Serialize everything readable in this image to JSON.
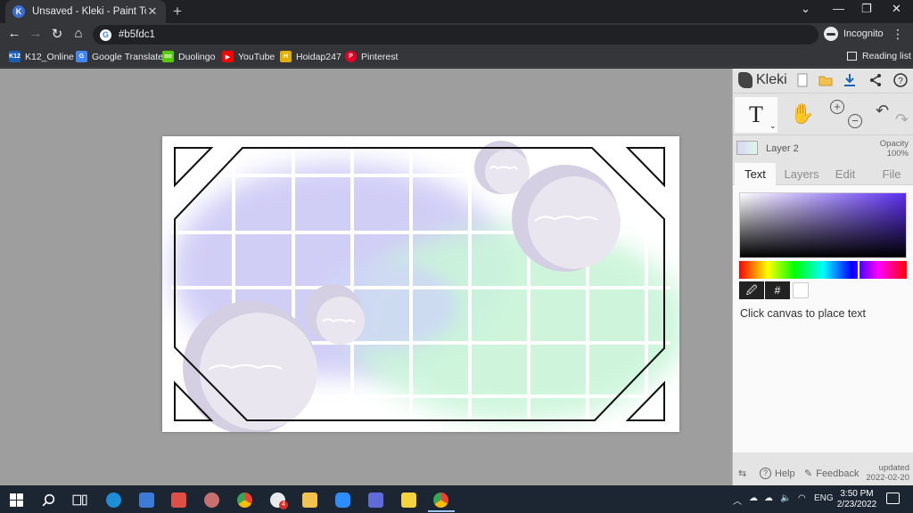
{
  "browser": {
    "tab_title": "Unsaved - Kleki - Paint Tool",
    "tab_favicon": "kleki-icon",
    "new_tab": "+",
    "url": "#b5fdc1",
    "incognito_label": "Incognito",
    "reading_list": "Reading list",
    "bookmarks": [
      {
        "label": "K12_Online",
        "icon_text": "K12",
        "color": "#1a5fb4"
      },
      {
        "label": "Google Translate",
        "icon_text": "G",
        "color": "#4285f4"
      },
      {
        "label": "Duolingo",
        "icon_text": "oo",
        "color": "#58cc02"
      },
      {
        "label": "YouTube",
        "icon_text": "▶",
        "color": "#ff0000"
      },
      {
        "label": "Hoidap247",
        "icon_text": "H",
        "color": "#e0b000"
      },
      {
        "label": "Pinterest",
        "icon_text": "P",
        "color": "#e60023"
      }
    ]
  },
  "kleki": {
    "logo": "Kleki",
    "layer_name": "Layer 2",
    "opacity_label": "Opacity",
    "opacity_value": "100%",
    "tabs": [
      {
        "label": "Text",
        "active": true
      },
      {
        "label": "Layers",
        "active": false
      },
      {
        "label": "Edit",
        "active": false
      },
      {
        "label": "File",
        "active": false
      }
    ],
    "hex_button": "#",
    "hint": "Click canvas to place text",
    "footer": {
      "help": "Help",
      "feedback": "Feedback",
      "updated_label": "updated",
      "updated_date": "2022-02-20"
    },
    "current_color": "#ffffff"
  },
  "taskbar": {
    "language": "ENG",
    "time": "3:50 PM",
    "date": "2/23/2022",
    "badge": "4"
  }
}
